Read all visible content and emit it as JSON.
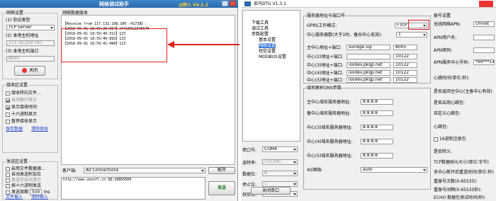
{
  "left": {
    "title": "网络调试助手",
    "version": "@野人 V4.2.2",
    "settings": {
      "group": "网络设置",
      "protocol_label": "(1) 协议类型",
      "protocol": "TCP Server",
      "local_ip_label": "(2) 本地主机地址",
      "local_ip": "172.16.209.197",
      "local_port_label": "(3) 本地主机端口",
      "local_port": "8005",
      "close_btn": "关闭"
    },
    "recv_group": "网络数据接收",
    "recv_lines": [
      "【Receive from 117.132.198.100 :41738】:",
      "【2018-09-01 18:59:26:654】x¥413612345678",
      "【2018-09-01 18:59:40:311】123",
      "【2018-09-01 18:59:40:892】123",
      "【2018-09-01 18:59:41:490】123"
    ],
    "recv_settings": {
      "title": "接收区设置",
      "opts": [
        "接收转向文件...",
        "自动换行显示",
        "显示接收时间",
        "十六进制显示",
        "暂停接收显示"
      ],
      "save": "保存数据",
      "clear": "清除接收"
    },
    "send_settings": {
      "title": "发送区设置",
      "opts": [
        "启用文件数据源...",
        "自动发送附加位",
        "发送完自动清空",
        "按十六进制发送",
        "发送周期"
      ],
      "period": "500",
      "ms": "ms",
      "load": "文件载入",
      "clear": "清除输入"
    },
    "client_label": "客户端:",
    "client_value": "All Connections",
    "disconnect_btn": "断开",
    "send_text": "http://www.cmsoft.cn QQ:10865600",
    "send_btn": "发送"
  },
  "right": {
    "title": "佰马DTU V1.3.1",
    "tree": [
      "下载工具",
      "调试工具",
      "参数配置",
      "基本设置",
      "网络设置",
      "短信设置",
      "MODBUS设置"
    ],
    "server_group": "服务器地址与端口号",
    "gprs_mode_label": "GPRS工作模式:",
    "gprs_mode": "FTCP",
    "center_count_label": "中心服务器数(大于1时，备份中心无效):",
    "center_count": "1",
    "centers": [
      {
        "label": "主中心地址+端口:",
        "addr": "sundge.vip",
        "port": "8005"
      },
      {
        "label": "中心(2)地址+端口:",
        "addr": "",
        "port": "10122"
      },
      {
        "label": "中心(3)地址+端口:",
        "addr": "isodev.pkqp.net",
        "port": "10122"
      },
      {
        "label": "中心(4)地址+端口:",
        "addr": "isodev.pkqp.net",
        "port": "10122"
      },
      {
        "label": "中心(5)地址+端口:",
        "addr": "isodev.pkqp.net",
        "port": "10122"
      }
    ],
    "dns_group": "域名解析DNS参数",
    "dns": [
      {
        "label": "主中心域名服务器地址:",
        "value": "8.8.8.8"
      },
      {
        "label": "备中心域名服务器地址:",
        "value": "8.8.8.8"
      },
      {
        "label": "中心(3)域名服务器地址:",
        "value": "8.8.8.8"
      },
      {
        "label": "中心(4)域名服务器地址:",
        "value": "8.8.8.8"
      },
      {
        "label": "中心(5)域名服务器地址:",
        "value": "8.8.8.8"
      }
    ],
    "ip_mode_label": "4G网络:",
    "ip_mode": "auto",
    "serial": [
      {
        "label": "串口号:",
        "value": "COM4"
      },
      {
        "label": "波特率:",
        "value": "115200"
      },
      {
        "label": "数据位:",
        "value": "8"
      },
      {
        "label": "停止位:",
        "value": "1"
      },
      {
        "label": "校验位:",
        "value": "None"
      }
    ],
    "close_port": "关闭串口",
    "apn": {
      "group": "拨号设置",
      "apn_label": "无线网络APN:",
      "apn": "cmnet",
      "user_label": "APN用户名:",
      "pass_label": "APN密码:",
      "center_label": "APN服务中心号码:",
      "center": "*99***1#"
    },
    "misc": [
      "心跳时间(单位:秒):",
      "是否返回主中心(主备中心有效)",
      "是否启用心跳包:",
      "心跳包:",
      "自定义心跳包:",
      "16进制注册包",
      "是否转义:",
      "TCP数据帧元大小(单位:字节)",
      "多中心断开后重连时间(单位:秒)",
      "重拨号次数(0-65535):",
      "重拨号间隔(0-65535秒):",
      "ECHO 数据包测试时间(秒):"
    ]
  }
}
